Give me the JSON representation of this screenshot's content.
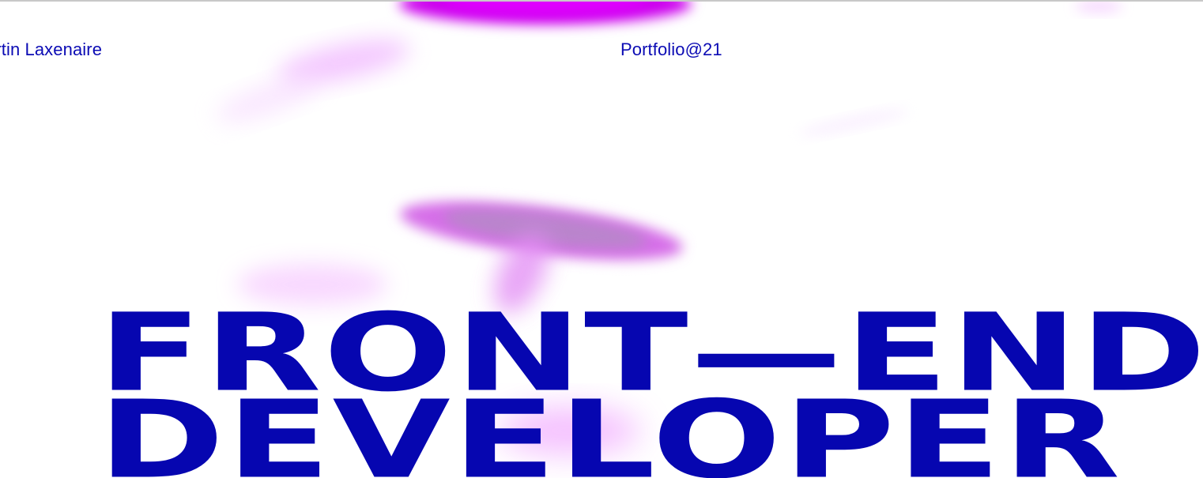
{
  "header": {
    "name": "artin Laxenaire",
    "portfolio_label": "Portfolio@21"
  },
  "hero": {
    "line1": "FRONT—END",
    "line2": "DEVELOPER"
  },
  "colors": {
    "text_blue": "#0b0bb4",
    "headline_blue": "#0606b0",
    "blob_magenta": "#d600ff"
  }
}
